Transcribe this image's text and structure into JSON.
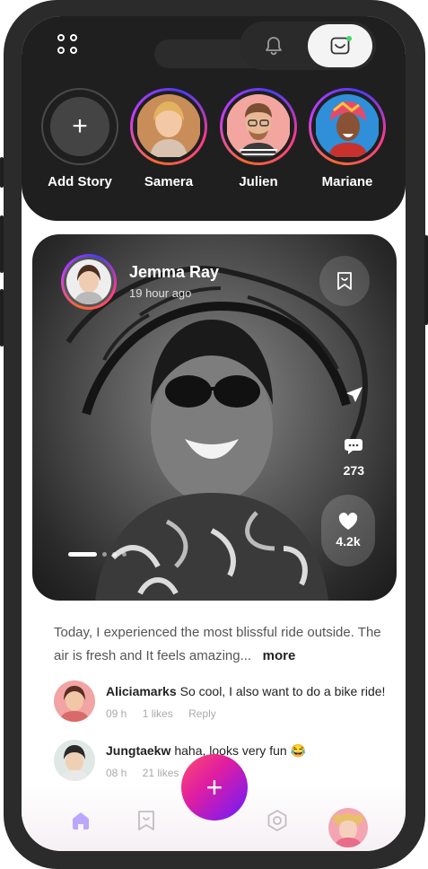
{
  "header": {
    "menu_icon": "grid-dots-icon",
    "notifications_icon": "bell-icon",
    "inbox_icon": "inbox-icon"
  },
  "stories": [
    {
      "label": "Add Story",
      "icon": "plus-icon"
    },
    {
      "label": "Samera"
    },
    {
      "label": "Julien"
    },
    {
      "label": "Mariane"
    }
  ],
  "post": {
    "author": "Jemma Ray",
    "time": "19 hour ago",
    "comments_count": "273",
    "likes_count": "4.2k",
    "caption": "Today, I experienced the most blissful ride outside. The air is fresh and It feels amazing...",
    "more_label": "more",
    "pager_total": 4,
    "pager_active": 1
  },
  "comments": [
    {
      "name": "Aliciamarks",
      "text": "So cool, I also want to do a bike ride!",
      "time": "09 h",
      "likes": "1 likes",
      "reply": "Reply"
    },
    {
      "name": "Jungtaekw",
      "text": "haha, looks very fun 😂",
      "time": "08 h",
      "likes": "21 likes"
    }
  ],
  "nav": {
    "items": [
      "home-icon",
      "bookmark-icon",
      "add-icon",
      "settings-icon",
      "profile-avatar"
    ],
    "fab_label": "+"
  },
  "colors": {
    "dark_bg": "#1f1f1f",
    "accent_gradient_start": "#ff4d6d",
    "accent_gradient_end": "#6a1bff",
    "home_active": "#b9a8ff"
  }
}
